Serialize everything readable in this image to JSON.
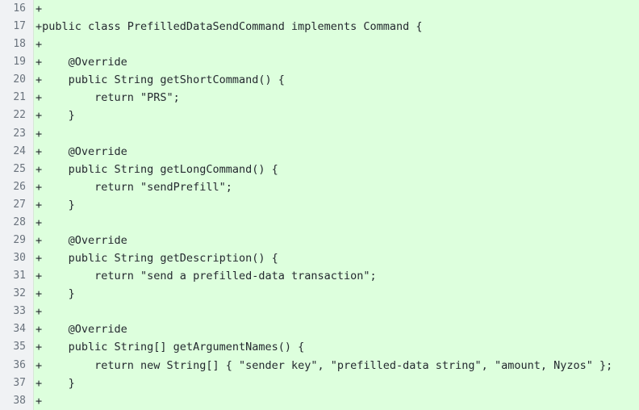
{
  "view": {
    "type": "unified-diff",
    "kind": "added-lines-only",
    "colors": {
      "addition_background": "#ddffdd",
      "gutter_background": "#f0f2f4",
      "line_number_text": "#6a737d",
      "code_text": "#24292f",
      "gutter_divider": "#d8e6d8"
    }
  },
  "diff": {
    "rows": [
      {
        "number": "16",
        "marker": "+",
        "code": "+"
      },
      {
        "number": "17",
        "marker": "+",
        "code": "+public class PrefilledDataSendCommand implements Command {"
      },
      {
        "number": "18",
        "marker": "+",
        "code": "+"
      },
      {
        "number": "19",
        "marker": "+",
        "code": "+    @Override"
      },
      {
        "number": "20",
        "marker": "+",
        "code": "+    public String getShortCommand() {"
      },
      {
        "number": "21",
        "marker": "+",
        "code": "+        return \"PRS\";"
      },
      {
        "number": "22",
        "marker": "+",
        "code": "+    }"
      },
      {
        "number": "23",
        "marker": "+",
        "code": "+"
      },
      {
        "number": "24",
        "marker": "+",
        "code": "+    @Override"
      },
      {
        "number": "25",
        "marker": "+",
        "code": "+    public String getLongCommand() {"
      },
      {
        "number": "26",
        "marker": "+",
        "code": "+        return \"sendPrefill\";"
      },
      {
        "number": "27",
        "marker": "+",
        "code": "+    }"
      },
      {
        "number": "28",
        "marker": "+",
        "code": "+"
      },
      {
        "number": "29",
        "marker": "+",
        "code": "+    @Override"
      },
      {
        "number": "30",
        "marker": "+",
        "code": "+    public String getDescription() {"
      },
      {
        "number": "31",
        "marker": "+",
        "code": "+        return \"send a prefilled-data transaction\";"
      },
      {
        "number": "32",
        "marker": "+",
        "code": "+    }"
      },
      {
        "number": "33",
        "marker": "+",
        "code": "+"
      },
      {
        "number": "34",
        "marker": "+",
        "code": "+    @Override"
      },
      {
        "number": "35",
        "marker": "+",
        "code": "+    public String[] getArgumentNames() {"
      },
      {
        "number": "36",
        "marker": "+",
        "code": "+        return new String[] { \"sender key\", \"prefilled-data string\", \"amount, Nyzos\" };"
      },
      {
        "number": "37",
        "marker": "+",
        "code": "+    }"
      },
      {
        "number": "38",
        "marker": "+",
        "code": "+"
      }
    ]
  }
}
